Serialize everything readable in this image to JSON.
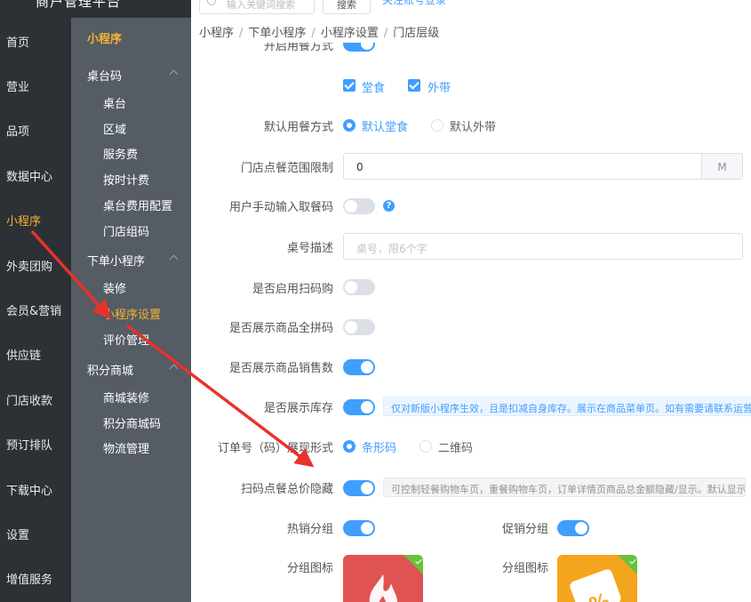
{
  "header": {
    "app_title": "商户管理平台",
    "search_placeholder": "输入关键词搜索",
    "search_button": "搜索",
    "top_link": "关注账号登录"
  },
  "nav_primary": [
    {
      "label": "首页",
      "active": false
    },
    {
      "label": "营业",
      "active": false
    },
    {
      "label": "品项",
      "active": false
    },
    {
      "label": "数据中心",
      "active": false
    },
    {
      "label": "小程序",
      "active": true
    },
    {
      "label": "外卖团购",
      "active": false
    },
    {
      "label": "会员&营销",
      "active": false
    },
    {
      "label": "供应链",
      "active": false
    },
    {
      "label": "门店收款",
      "active": false
    },
    {
      "label": "预订排队",
      "active": false
    },
    {
      "label": "下载中心",
      "active": false
    },
    {
      "label": "设置",
      "active": false
    },
    {
      "label": "增值服务",
      "active": false
    }
  ],
  "nav_secondary": {
    "title": "小程序",
    "groups": [
      {
        "label": "桌台码",
        "items": [
          "桌台",
          "区域",
          "服务费",
          "按时计费",
          "桌台费用配置",
          "门店组码"
        ]
      },
      {
        "label": "下单小程序",
        "items": [
          "装修",
          "小程序设置",
          "评价管理"
        ]
      },
      {
        "label": "积分商城",
        "items": [
          "商城装修",
          "积分商城码",
          "物流管理"
        ]
      }
    ],
    "active_item": "小程序设置"
  },
  "breadcrumb": [
    "小程序",
    "下单小程序",
    "小程序设置",
    "门店层级"
  ],
  "form": {
    "cut_label": "开启用餐方式",
    "dine_options": [
      {
        "label": "堂食",
        "checked": true
      },
      {
        "label": "外带",
        "checked": true
      }
    ],
    "default_mode": {
      "label": "默认用餐方式",
      "options": [
        "默认堂食",
        "默认外带"
      ],
      "selected": "默认堂食"
    },
    "range_limit": {
      "label": "门店点餐范围限制",
      "value": "0",
      "unit": "M"
    },
    "manual_input": {
      "label": "用户手动输入取餐码",
      "on": false
    },
    "table_desc": {
      "label": "桌号描述",
      "placeholder": "桌号，限6个字"
    },
    "scan_buy": {
      "label": "是否启用扫码购",
      "on": false
    },
    "show_spell": {
      "label": "是否展示商品全拼码",
      "on": false
    },
    "show_sales": {
      "label": "是否展示商品销售数",
      "on": true
    },
    "show_stock": {
      "label": "是否展示库存",
      "on": true,
      "tip": "仅对新版小程序生效，且是扣减自身库存。展示在商品菜单页。如有需要请联系运营开通"
    },
    "order_code": {
      "label": "订单号（码）展现形式",
      "options": [
        "条形码",
        "二维码"
      ],
      "selected": "条形码"
    },
    "hide_total": {
      "label": "扫码点餐总价隐藏",
      "on": true,
      "tip": "可控制轻餐购物车页，重餐购物车页，订单详情页商品总金额隐藏/显示。默认显示"
    },
    "hot_group": {
      "label": "热销分组",
      "on": true,
      "icon_label": "分组图标"
    },
    "promo_group": {
      "label": "促销分组",
      "on": true,
      "icon_label": "分组图标"
    }
  },
  "colors": {
    "primary": "#409eff",
    "nav_active": "#f5b333",
    "annotation_arrow": "#e8322b",
    "hot_icon_bg": "#e05353",
    "promo_icon_bg": "#f3a51d"
  }
}
